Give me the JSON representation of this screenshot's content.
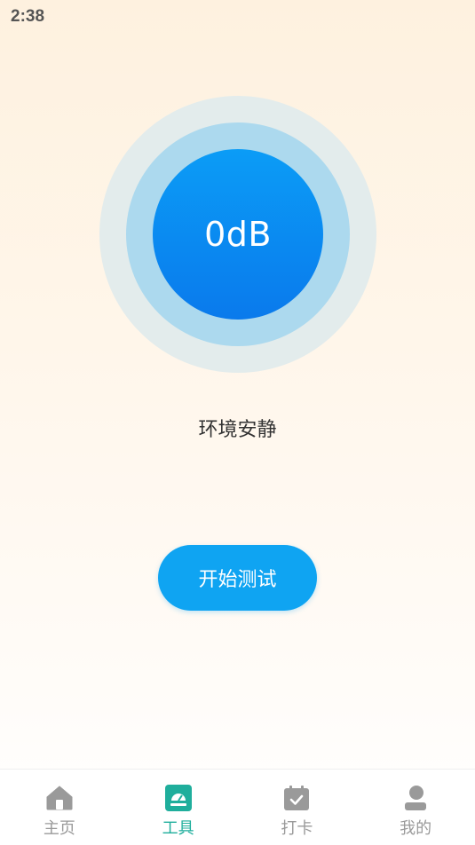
{
  "status_bar": {
    "time": "2:38"
  },
  "meter": {
    "value": "0dB",
    "status": "环境安静"
  },
  "actions": {
    "start_label": "开始测试"
  },
  "tab_bar": {
    "active_index": 1,
    "tabs": [
      {
        "label": "主页",
        "icon": "home-icon"
      },
      {
        "label": "工具",
        "icon": "gauge-icon"
      },
      {
        "label": "打卡",
        "icon": "calendar-check-icon"
      },
      {
        "label": "我的",
        "icon": "user-icon"
      }
    ]
  },
  "colors": {
    "accent_blue": "#0fa4f2",
    "active_tab": "#1fae9c",
    "inactive_tab": "#9a9a9a"
  }
}
